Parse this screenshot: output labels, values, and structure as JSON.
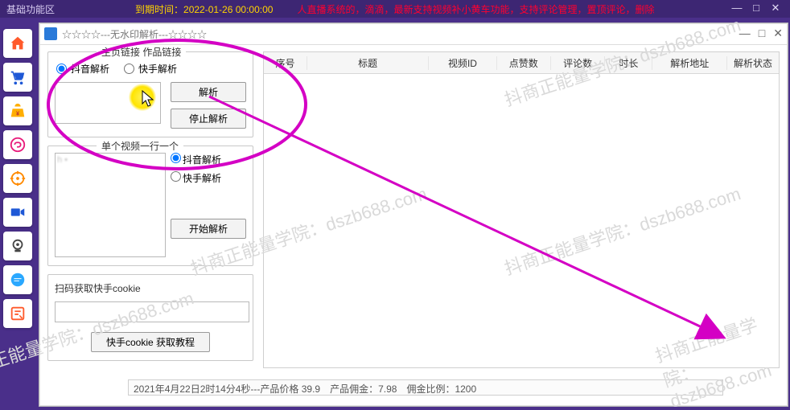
{
  "titlebar": {
    "section_label": "基础功能区",
    "expire_text": "到期时间：2022-01-26 00:00:00",
    "marquee_text": "人直播系统的，滴滴，最新支持视频补小黄车功能，支持评论管理，置顶评论，删除"
  },
  "child_window": {
    "title": "☆☆☆☆---无水印解析---☆☆☆☆"
  },
  "panel_links": {
    "legend": "主页链接 作品链接",
    "radio_douyin": "抖音解析",
    "radio_kuaishou": "快手解析",
    "btn_parse": "解析",
    "btn_stop": "停止解析"
  },
  "panel_multi": {
    "legend": "单个视频一行一个",
    "radio_douyin": "抖音解析",
    "radio_kuaishou": "快手解析",
    "btn_start": "开始解析",
    "sample_text": "h\n•"
  },
  "panel_scan": {
    "label": "扫码获取快手cookie",
    "btn_guide": "快手cookie 获取教程"
  },
  "table": {
    "headers": [
      "序号",
      "标题",
      "视频ID",
      "点赞数",
      "评论数",
      "时长",
      "解析地址",
      "解析状态"
    ]
  },
  "status": {
    "text": "2021年4月22日2时14分4秒---产品价格 39.9　产品佣金：7.98　佣金比例：1200"
  },
  "watermark": "抖商正能量学院：dszb688.com"
}
